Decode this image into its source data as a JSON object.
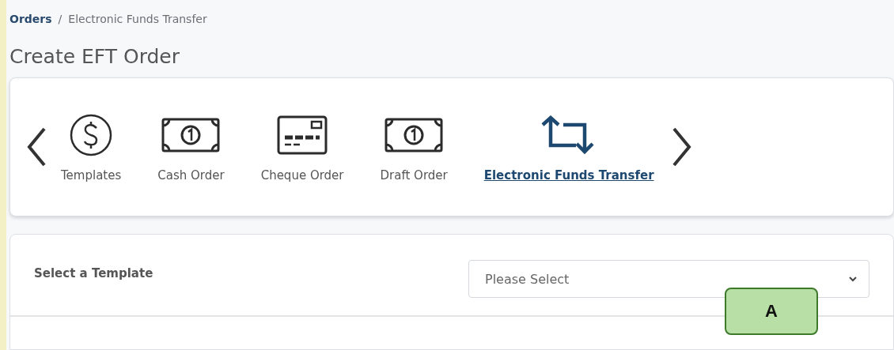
{
  "breadcrumb": [
    {
      "label": "Orders",
      "kind": "link"
    },
    {
      "label": "/",
      "kind": "separator"
    },
    {
      "label": "Electronic Funds Transfer",
      "kind": "current"
    }
  ],
  "page_title": "Create EFT Order",
  "order_types": [
    {
      "label": "Templates",
      "kind": "dollar",
      "selected": false
    },
    {
      "label": "Cash Order",
      "kind": "bill",
      "selected": false
    },
    {
      "label": "Cheque Order",
      "kind": "cheque",
      "selected": false
    },
    {
      "label": "Draft Order",
      "kind": "bill",
      "selected": false
    },
    {
      "label": "Electronic Funds Transfer",
      "kind": "transfer",
      "selected": true
    }
  ],
  "template": {
    "label": "Select a Template",
    "placeholder": "Please Select"
  },
  "callout": "A"
}
